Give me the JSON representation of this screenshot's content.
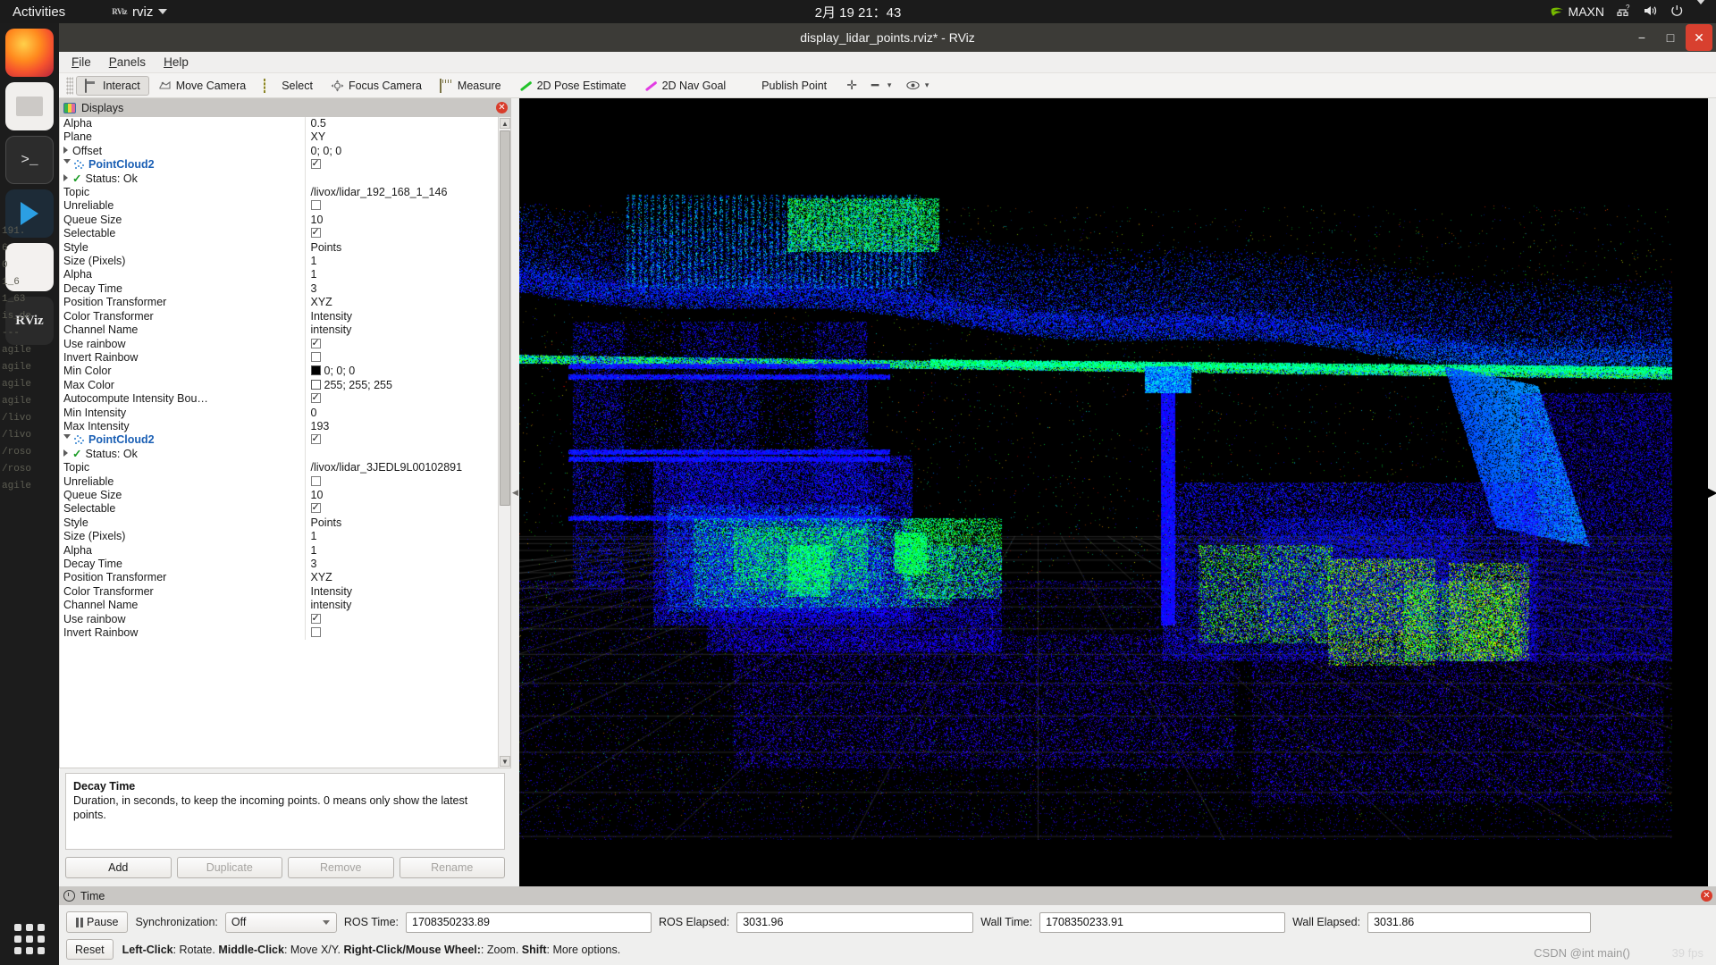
{
  "desktop": {
    "activities": "Activities",
    "app_name": "rviz",
    "app_icon": "RViz",
    "clock": "2月 19 21：43",
    "tray": {
      "gpu_label": "MAXN",
      "icons": [
        "nvidia-icon",
        "network-icon",
        "volume-icon",
        "power-icon",
        "chevron-down-icon"
      ]
    },
    "dock": [
      {
        "name": "firefox",
        "label": "Firefox"
      },
      {
        "name": "files",
        "label": "Files"
      },
      {
        "name": "terminal",
        "label": "Terminal"
      },
      {
        "name": "vscode",
        "label": "Visual Studio Code"
      },
      {
        "name": "help",
        "label": "Help"
      },
      {
        "name": "rviz",
        "label": "RViz"
      },
      {
        "name": "show-apps",
        "label": "Show Applications"
      }
    ],
    "terminal_bleed": "191.\n6\n0\n1_6\n1_63\nis_de\n---\nagile\nagile\nagile\nagile\n/livo\n/livo\n/roso\n/roso\nagile"
  },
  "window": {
    "title": "display_lidar_points.rviz* - RViz",
    "buttons": {
      "minimize": "−",
      "maximize": "□",
      "close": "✕"
    }
  },
  "menubar": [
    {
      "label": "File",
      "accel": "F"
    },
    {
      "label": "Panels",
      "accel": "P"
    },
    {
      "label": "Help",
      "accel": "H"
    }
  ],
  "toolbar": [
    {
      "label": "Interact",
      "icon": "hand-icon",
      "active": true
    },
    {
      "label": "Move Camera",
      "icon": "move-camera-icon",
      "active": false
    },
    {
      "label": "Select",
      "icon": "select-icon",
      "active": false
    },
    {
      "label": "Focus Camera",
      "icon": "focus-camera-icon",
      "active": false
    },
    {
      "label": "Measure",
      "icon": "measure-icon",
      "active": false
    },
    {
      "label": "2D Pose Estimate",
      "icon": "pose-estimate-arrow-icon",
      "active": false
    },
    {
      "label": "2D Nav Goal",
      "icon": "nav-goal-arrow-icon",
      "active": false
    },
    {
      "label": "Publish Point",
      "icon": "publish-point-pin-icon",
      "active": false
    }
  ],
  "toolbar_extra": [
    {
      "name": "add-tool-icon",
      "glyph": "✛"
    },
    {
      "name": "remove-tool-icon",
      "glyph": "━"
    },
    {
      "name": "remove-tool-chevron-icon",
      "glyph": "▾"
    },
    {
      "name": "eye-tool-icon",
      "glyph": "👁"
    },
    {
      "name": "eye-tool-chevron-icon",
      "glyph": "▾"
    }
  ],
  "displays": {
    "panel_title": "Displays",
    "rows": [
      {
        "indent": 1,
        "name": "Alpha",
        "value": "0.5",
        "type": "text"
      },
      {
        "indent": 1,
        "name": "Plane",
        "value": "XY",
        "type": "text"
      },
      {
        "indent": 1,
        "name": "Offset",
        "value": "0; 0; 0",
        "type": "text",
        "expander": "closed"
      },
      {
        "indent": 0,
        "name": "PointCloud2",
        "value": "",
        "type": "check-on",
        "expander": "open",
        "node": true
      },
      {
        "indent": 2,
        "name": "Status: Ok",
        "value": "",
        "type": "none",
        "expander": "closed",
        "status": true
      },
      {
        "indent": 1,
        "name": "Topic",
        "value": "/livox/lidar_192_168_1_146",
        "type": "text"
      },
      {
        "indent": 1,
        "name": "Unreliable",
        "value": "",
        "type": "check-off"
      },
      {
        "indent": 1,
        "name": "Queue Size",
        "value": "10",
        "type": "text"
      },
      {
        "indent": 1,
        "name": "Selectable",
        "value": "",
        "type": "check-on"
      },
      {
        "indent": 1,
        "name": "Style",
        "value": "Points",
        "type": "text"
      },
      {
        "indent": 1,
        "name": "Size (Pixels)",
        "value": "1",
        "type": "text"
      },
      {
        "indent": 1,
        "name": "Alpha",
        "value": "1",
        "type": "text"
      },
      {
        "indent": 1,
        "name": "Decay Time",
        "value": "3",
        "type": "text"
      },
      {
        "indent": 1,
        "name": "Position Transformer",
        "value": "XYZ",
        "type": "text"
      },
      {
        "indent": 1,
        "name": "Color Transformer",
        "value": "Intensity",
        "type": "text"
      },
      {
        "indent": 1,
        "name": "Channel Name",
        "value": "intensity",
        "type": "text"
      },
      {
        "indent": 1,
        "name": "Use rainbow",
        "value": "",
        "type": "check-on"
      },
      {
        "indent": 1,
        "name": "Invert Rainbow",
        "value": "",
        "type": "check-off"
      },
      {
        "indent": 1,
        "name": "Min Color",
        "value": "0; 0; 0",
        "type": "swatch",
        "swatch": "#000000"
      },
      {
        "indent": 1,
        "name": "Max Color",
        "value": "255; 255; 255",
        "type": "swatch",
        "swatch": "#ffffff"
      },
      {
        "indent": 1,
        "name": "Autocompute Intensity Bou…",
        "value": "",
        "type": "check-on"
      },
      {
        "indent": 1,
        "name": "Min Intensity",
        "value": "0",
        "type": "text"
      },
      {
        "indent": 1,
        "name": "Max Intensity",
        "value": "193",
        "type": "text"
      },
      {
        "indent": 0,
        "name": "PointCloud2",
        "value": "",
        "type": "check-on",
        "expander": "open",
        "node": true
      },
      {
        "indent": 2,
        "name": "Status: Ok",
        "value": "",
        "type": "none",
        "expander": "closed",
        "status": true
      },
      {
        "indent": 1,
        "name": "Topic",
        "value": "/livox/lidar_3JEDL9L00102891",
        "type": "text"
      },
      {
        "indent": 1,
        "name": "Unreliable",
        "value": "",
        "type": "check-off"
      },
      {
        "indent": 1,
        "name": "Queue Size",
        "value": "10",
        "type": "text"
      },
      {
        "indent": 1,
        "name": "Selectable",
        "value": "",
        "type": "check-on"
      },
      {
        "indent": 1,
        "name": "Style",
        "value": "Points",
        "type": "text"
      },
      {
        "indent": 1,
        "name": "Size (Pixels)",
        "value": "1",
        "type": "text"
      },
      {
        "indent": 1,
        "name": "Alpha",
        "value": "1",
        "type": "text"
      },
      {
        "indent": 1,
        "name": "Decay Time",
        "value": "3",
        "type": "text"
      },
      {
        "indent": 1,
        "name": "Position Transformer",
        "value": "XYZ",
        "type": "text"
      },
      {
        "indent": 1,
        "name": "Color Transformer",
        "value": "Intensity",
        "type": "text"
      },
      {
        "indent": 1,
        "name": "Channel Name",
        "value": "intensity",
        "type": "text"
      },
      {
        "indent": 1,
        "name": "Use rainbow",
        "value": "",
        "type": "check-on"
      },
      {
        "indent": 1,
        "name": "Invert Rainbow",
        "value": "",
        "type": "check-off"
      }
    ],
    "description": {
      "title": "Decay Time",
      "body": "Duration, in seconds, to keep the incoming points. 0 means only show the latest points."
    },
    "buttons": [
      {
        "label": "Add",
        "enabled": true
      },
      {
        "label": "Duplicate",
        "enabled": false
      },
      {
        "label": "Remove",
        "enabled": false
      },
      {
        "label": "Rename",
        "enabled": false
      }
    ]
  },
  "time_panel": {
    "title": "Time",
    "pause_label": "Pause",
    "sync_label": "Synchronization:",
    "sync_value": "Off",
    "ros_time_label": "ROS Time:",
    "ros_time_value": "1708350233.89",
    "ros_elapsed_label": "ROS Elapsed:",
    "ros_elapsed_value": "3031.96",
    "wall_time_label": "Wall Time:",
    "wall_time_value": "1708350233.91",
    "wall_elapsed_label": "Wall Elapsed:",
    "wall_elapsed_value": "3031.86",
    "reset_label": "Reset",
    "hint": {
      "k1": "Left-Click",
      "t1": ": Rotate. ",
      "k2": "Middle-Click",
      "t2": ": Move X/Y. ",
      "k3": "Right-Click/Mouse Wheel:",
      "t3": ": Zoom. ",
      "k4": "Shift",
      "t4": ": More options."
    },
    "fps": "39 fps",
    "watermark": "CSDN @int main()"
  }
}
